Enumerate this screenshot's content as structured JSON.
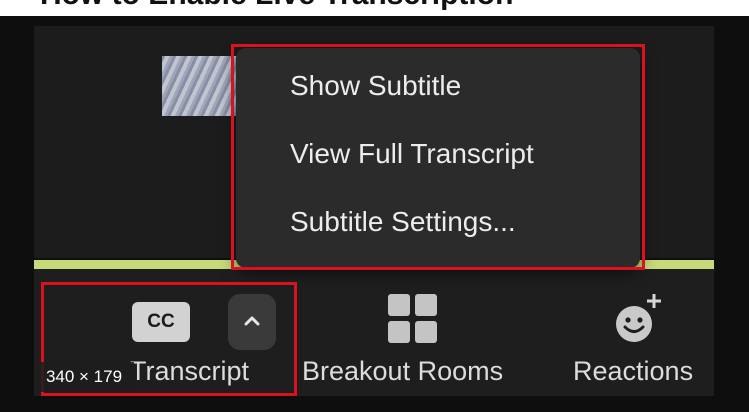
{
  "heading": {
    "text": "How to Enable Live Transcription"
  },
  "menu": {
    "items": [
      {
        "label": "Show Subtitle"
      },
      {
        "label": "View Full Transcript"
      },
      {
        "label": "Subtitle Settings..."
      }
    ]
  },
  "toolbar": {
    "transcript": {
      "badge": "CC",
      "label": "Transcript",
      "icon": "closed-caption-icon"
    },
    "breakout": {
      "label": "Breakout Rooms",
      "icon": "grid-icon"
    },
    "reactions": {
      "label": "Reactions",
      "icon": "emoji-add-icon"
    }
  },
  "overlay": {
    "size_badge": "340 × 179"
  },
  "colors": {
    "highlight": "#d8121f",
    "menu_bg": "#2b2b2b",
    "toolbar_bg": "#1e1e1e",
    "strip": "#c6da79"
  }
}
